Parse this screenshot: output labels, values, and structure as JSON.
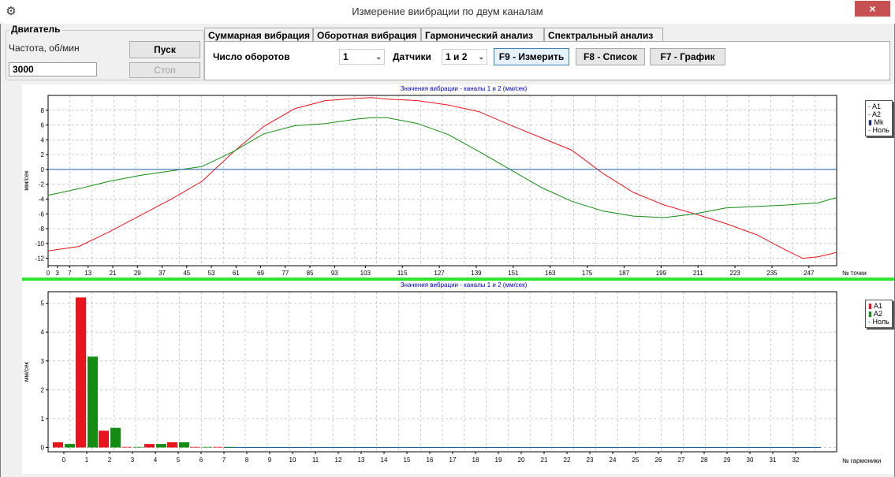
{
  "window": {
    "title": "Измерение виибрации по двум каналам",
    "close_label": "×"
  },
  "engine": {
    "group_title": "Двигатель",
    "freq_label": "Частота, об/мин",
    "freq_value": "3000",
    "start_label": "Пуск",
    "stop_label": "Стоп"
  },
  "tabs": [
    {
      "label": "Суммарная вибрация",
      "active": false
    },
    {
      "label": "Оборотная вибрация",
      "active": false
    },
    {
      "label": "Гармонический анализ",
      "active": true
    },
    {
      "label": "Спектральный анализ",
      "active": false
    }
  ],
  "toolbar": {
    "rpm_label": "Число оборотов",
    "rpm_value": "1",
    "sensors_label": "Датчики",
    "sensors_value": "1 и 2",
    "measure_label": "F9 - Измерить",
    "list_label": "F8 - Список",
    "graph_label": "F7 - График"
  },
  "colors": {
    "a1": "#e8141e",
    "a2": "#148c14",
    "zero": "#1a5fa8",
    "separator": "#2ee62e",
    "title_blue": "#0000c8"
  },
  "chart_data": [
    {
      "type": "line",
      "title": "Значения вибрации  - каналы 1 и 2 (мм/сек)",
      "ylabel": "мм/сек",
      "xlabel": "№ точки",
      "ylim": [
        -13,
        10
      ],
      "xlim": [
        0,
        256
      ],
      "yticks": [
        8,
        6,
        4,
        2,
        0,
        -2,
        -4,
        -6,
        -8,
        -10,
        -12
      ],
      "xticks": [
        0,
        3,
        7,
        13,
        21,
        29,
        37,
        45,
        53,
        61,
        69,
        77,
        85,
        93,
        103,
        115,
        127,
        139,
        151,
        163,
        175,
        187,
        199,
        211,
        223,
        235,
        247
      ],
      "grid": true,
      "legend": [
        "A1",
        "A2",
        "Mk",
        "Ноль"
      ],
      "legend_position": "top-right",
      "series": [
        {
          "name": "A1",
          "x": [
            0,
            10,
            20,
            30,
            40,
            50,
            60,
            70,
            80,
            90,
            100,
            105,
            110,
            120,
            130,
            140,
            150,
            160,
            170,
            180,
            190,
            200,
            210,
            220,
            230,
            240,
            245,
            250,
            256
          ],
          "y": [
            -11,
            -10.4,
            -8.4,
            -6.2,
            -4,
            -1.6,
            2.3,
            5.8,
            8.2,
            9.3,
            9.6,
            9.7,
            9.5,
            9.3,
            8.7,
            7.8,
            6,
            4.3,
            2.6,
            -0.5,
            -3.1,
            -4.8,
            -6,
            -7.3,
            -8.8,
            -11,
            -12,
            -11.8,
            -11.2
          ]
        },
        {
          "name": "A2",
          "x": [
            0,
            10,
            20,
            30,
            40,
            50,
            60,
            70,
            80,
            90,
            100,
            105,
            110,
            120,
            130,
            140,
            150,
            160,
            170,
            180,
            190,
            200,
            210,
            220,
            230,
            240,
            250,
            256
          ],
          "y": [
            -3.5,
            -2.6,
            -1.6,
            -0.8,
            -0.2,
            0.4,
            2.4,
            4.8,
            5.9,
            6.2,
            6.8,
            7,
            7,
            6.2,
            4.7,
            2.4,
            0,
            -2.4,
            -4.3,
            -5.6,
            -6.3,
            -6.5,
            -6,
            -5.2,
            -5,
            -4.8,
            -4.5,
            -3.8
          ]
        },
        {
          "name": "Ноль",
          "x": [
            0,
            256
          ],
          "y": [
            0,
            0
          ]
        }
      ]
    },
    {
      "type": "bar",
      "title": "Значения вибрации  - каналы 1 и 2 (мм/сек)",
      "ylabel": "мм/сек",
      "xlabel": "№ гармоники",
      "ylim": [
        -0.15,
        5.4
      ],
      "yticks": [
        0,
        1,
        2,
        3,
        4,
        5
      ],
      "categories": [
        "0",
        "1",
        "2",
        "3",
        "4",
        "5",
        "6",
        "7",
        "8",
        "9",
        "10",
        "11",
        "12",
        "13",
        "14",
        "15",
        "16",
        "17",
        "18",
        "19",
        "20",
        "21",
        "22",
        "23",
        "24",
        "25",
        "26",
        "27",
        "28",
        "29",
        "30",
        "31",
        "32"
      ],
      "grid": true,
      "legend": [
        "A1",
        "A2",
        "Ноль"
      ],
      "legend_position": "top-right",
      "series": [
        {
          "name": "A1",
          "values": [
            0.18,
            5.2,
            0.58,
            0.02,
            0.12,
            0.18,
            0.02,
            0.02,
            0,
            0,
            0,
            0,
            0,
            0,
            0,
            0,
            0,
            0,
            0,
            0,
            0,
            0,
            0,
            0,
            0,
            0,
            0,
            0,
            0,
            0,
            0,
            0,
            0
          ]
        },
        {
          "name": "A2",
          "values": [
            0.12,
            3.15,
            0.68,
            0.02,
            0.12,
            0.18,
            0.02,
            0.02,
            0,
            0,
            0,
            0,
            0,
            0,
            0,
            0,
            0,
            0,
            0,
            0,
            0,
            0,
            0,
            0,
            0,
            0,
            0,
            0,
            0,
            0,
            0,
            0,
            0
          ]
        }
      ]
    }
  ]
}
